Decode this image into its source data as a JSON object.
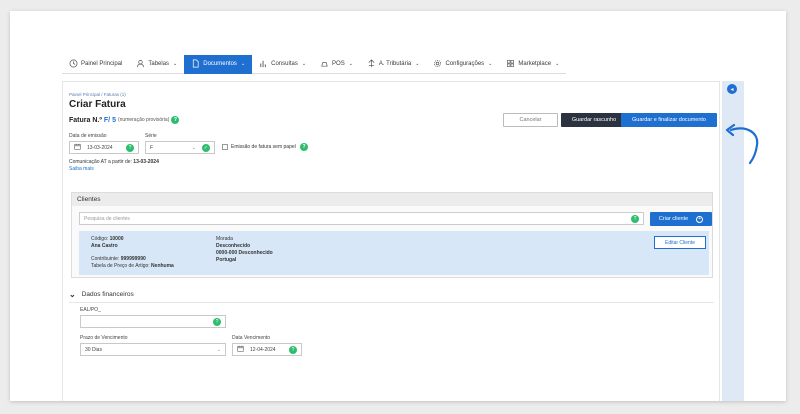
{
  "nav": {
    "items": [
      {
        "label": "Painel Principal",
        "icon": "clock-icon",
        "chevron": false
      },
      {
        "label": "Tabelas",
        "icon": "users-icon",
        "chevron": true
      },
      {
        "label": "Documentos",
        "icon": "document-icon",
        "chevron": true,
        "active": true
      },
      {
        "label": "Consultas",
        "icon": "bar-chart-icon",
        "chevron": true
      },
      {
        "label": "POS",
        "icon": "pos-icon",
        "chevron": true
      },
      {
        "label": "A. Tributária",
        "icon": "tax-icon",
        "chevron": true
      },
      {
        "label": "Configurações",
        "icon": "gear-icon",
        "chevron": true
      },
      {
        "label": "Marketplace",
        "icon": "grid-icon",
        "chevron": true
      }
    ]
  },
  "page": {
    "breadcrumb": "Painel Principal  /  Faturas (1)",
    "title": "Criar Fatura",
    "fatura_label": "Fatura N.º",
    "fatura_series": "F/ 5",
    "fatura_note": "(numeração provisória)"
  },
  "actions": {
    "cancel": "Cancelar",
    "draft": "Guardar rascunho",
    "finalize": "Guardar e finalizar documento"
  },
  "form": {
    "issue_date_label": "Data de emissão",
    "issue_date_value": "13-03-2024",
    "series_label": "Série",
    "series_value": "F",
    "paperless_label": "Emissão de fatura sem papel",
    "comm_prefix": "Comunicação AT a partir de:",
    "comm_date": "13-03-2024",
    "learn_more": "Saiba mais"
  },
  "clients": {
    "header": "Clientes",
    "search_placeholder": "Pesquisa de clientes",
    "create_button": "Criar cliente",
    "code_label": "Código:",
    "code_value": "10000",
    "name": "Ana Castro",
    "taxpayer_label": "Contribuinte:",
    "taxpayer_value": "999999990",
    "price_table_label": "Tabela de Preço de Artigo:",
    "price_table_value": "Nenhuma",
    "address_label": "Morada",
    "address_line1": "Desconhecido",
    "address_line2": "0000-000 Desconhecido",
    "address_line3": "Portugal",
    "edit_button": "Editar Cliente"
  },
  "financial": {
    "header": "Dados financeiros",
    "ref_label": "EAL/PO_",
    "due_term_label": "Prazo de Vencimento",
    "due_term_value": "30 Dias",
    "due_date_label": "Data Vencimento",
    "due_date_value": "12-04-2024"
  },
  "colors": {
    "accent": "#1f6fd1",
    "dark_button": "#2c3340",
    "success": "#2dbd6e"
  }
}
